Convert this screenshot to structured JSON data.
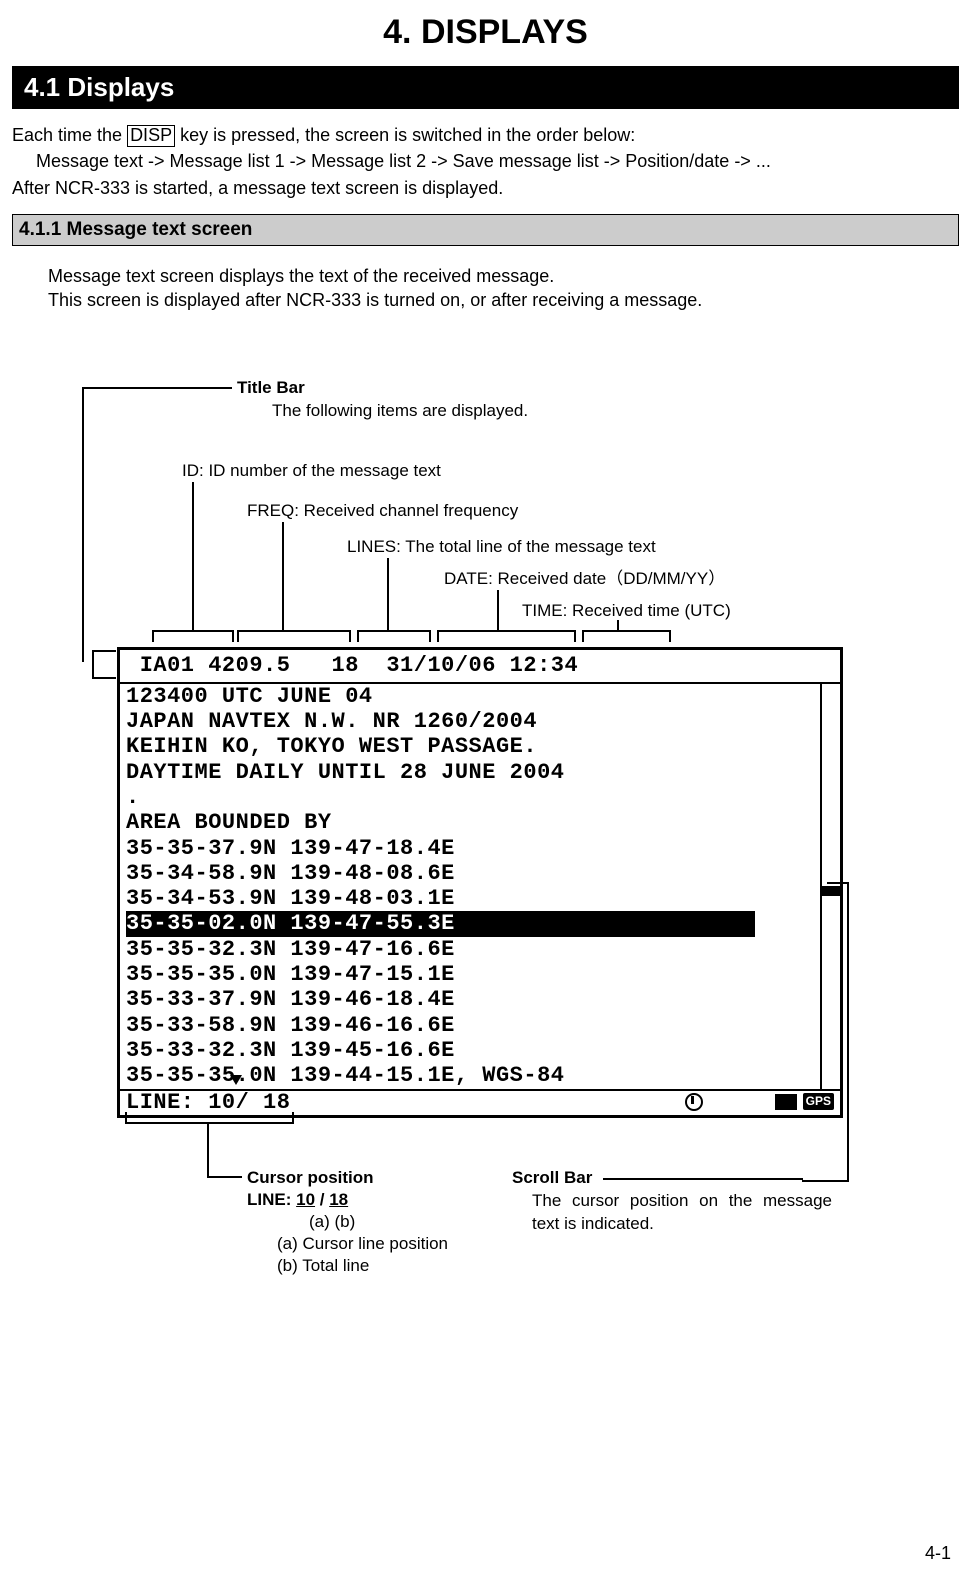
{
  "chapter_title": "4. DISPLAYS",
  "section_bar": "4.1   Displays",
  "intro_prefix": "Each time the ",
  "disp_key": "DISP",
  "intro_suffix": " key is pressed, the screen is switched in the order below:",
  "flow_line": "Message text -> Message list 1 -> Message list 2 -> Save message list -> Position/date -> ...",
  "after_line": "After NCR-333 is started, a message text screen is displayed.",
  "subsection": "4.1.1 Message text screen",
  "sub_p1": "Message text screen displays the text of the received message.",
  "sub_p2": "This screen is displayed after NCR-333 is turned on, or after receiving a message.",
  "titlebar_label": "Title Bar",
  "titlebar_desc": "The following items are displayed.",
  "id_label": "ID: ID number of the message text",
  "freq_label": "FREQ: Received channel frequency",
  "lines_label": "LINES: The total line of the message text",
  "date_label": "DATE: Received date（DD/MM/YY）",
  "time_label": "TIME: Received time (UTC)",
  "lcd_title": " IA01 4209.5   18  31/10/06 12:34",
  "lcd_lines": [
    "123400 UTC JUNE 04",
    "JAPAN NAVTEX N.W. NR 1260/2004",
    "KEIHIN KO, TOKYO WEST PASSAGE.",
    "DAYTIME DAILY UNTIL 28 JUNE 2004",
    ".",
    "AREA BOUNDED BY",
    "35-35-37.9N 139-47-18.4E",
    "35-34-58.9N 139-48-08.6E",
    "35-34-53.9N 139-48-03.1E",
    "35-35-02.0N 139-47-55.3E",
    "35-35-32.3N 139-47-16.6E",
    "35-35-35.0N 139-47-15.1E",
    "35-33-37.9N 139-46-18.4E",
    "35-33-58.9N 139-46-16.6E",
    "35-33-32.3N 139-45-16.6E",
    "35-35-35.0N 139-44-15.1E, WGS-84"
  ],
  "lcd_highlight_index": 9,
  "lcd_status": "LINE: 10/ 18",
  "gps_text": "GPS",
  "cursor_label": "Cursor position",
  "cursor_line_prefix": "LINE:   ",
  "cursor_a": "10",
  "cursor_sep": " /   ",
  "cursor_b": "18",
  "cursor_ab_row": "(a)      (b)",
  "cursor_a_desc": "(a) Cursor line position",
  "cursor_b_desc": "(b) Total line",
  "scroll_label": "Scroll Bar",
  "scroll_desc": "The cursor position on the message text is indicated.",
  "page_number": "4-1"
}
